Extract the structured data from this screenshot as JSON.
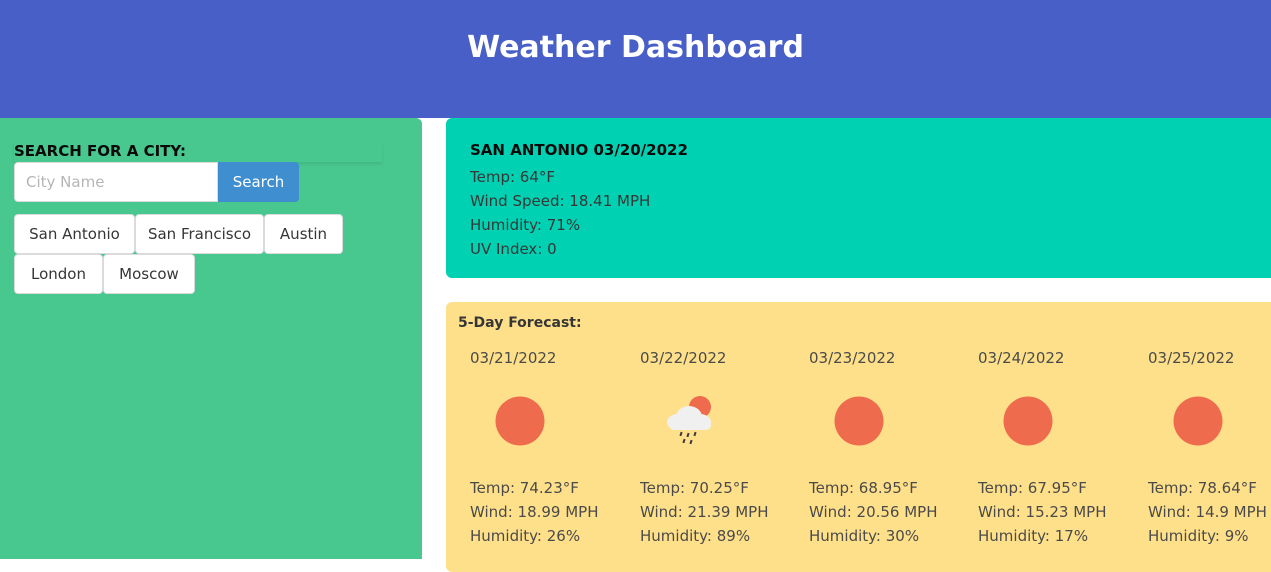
{
  "header": {
    "title": "Weather Dashboard"
  },
  "search": {
    "label": "SEARCH FOR A CITY:",
    "placeholder": "City Name",
    "button_label": "Search"
  },
  "history": [
    "San Antonio",
    "San Francisco",
    "Austin",
    "London",
    "Moscow"
  ],
  "current": {
    "city_date": "SAN ANTONIO 03/20/2022",
    "temp": "Temp: 64°F",
    "wind": "Wind Speed: 18.41 MPH",
    "humidity": "Humidity: 71%",
    "uv": "UV Index: 0"
  },
  "forecast": {
    "title": "5-Day Forecast:",
    "days": [
      {
        "date": "03/21/2022",
        "icon": "sun-icon",
        "temp": "Temp: 74.23°F",
        "wind": "Wind: 18.99 MPH",
        "humidity": "Humidity: 26%"
      },
      {
        "date": "03/22/2022",
        "icon": "rain-cloud-sun-icon",
        "temp": "Temp: 70.25°F",
        "wind": "Wind: 21.39 MPH",
        "humidity": "Humidity: 89%"
      },
      {
        "date": "03/23/2022",
        "icon": "sun-icon",
        "temp": "Temp: 68.95°F",
        "wind": "Wind: 20.56 MPH",
        "humidity": "Humidity: 30%"
      },
      {
        "date": "03/24/2022",
        "icon": "sun-icon",
        "temp": "Temp: 67.95°F",
        "wind": "Wind: 15.23 MPH",
        "humidity": "Humidity: 17%"
      },
      {
        "date": "03/25/2022",
        "icon": "sun-icon",
        "temp": "Temp: 78.64°F",
        "wind": "Wind: 14.9 MPH",
        "humidity": "Humidity: 9%"
      }
    ]
  },
  "colors": {
    "header": "#485fc7",
    "sidebar": "#48c78e",
    "current_card": "#00d1b2",
    "forecast_card": "#ffe08a",
    "search_button": "#3e8ed0",
    "sun": "#ee6c4d"
  }
}
